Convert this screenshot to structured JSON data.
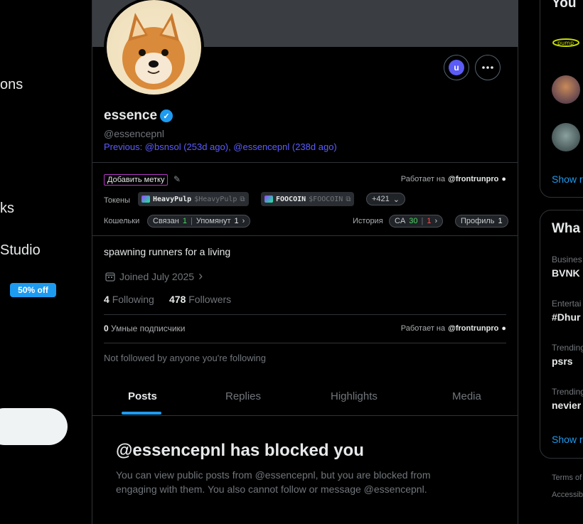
{
  "left_nav": {
    "items": [
      {
        "label": "ons"
      },
      {
        "label": "ks"
      },
      {
        "label": "Studio"
      }
    ],
    "promo_badge": "50% off"
  },
  "profile": {
    "name": "essence",
    "handle": "@essencepnl",
    "previous": "Previous: @bsnsol (253d ago), @essencepnl (238d ago)",
    "bio": "spawning runners for a living",
    "joined": "Joined July 2025",
    "following_count": "4",
    "following_label": "Following",
    "followers_count": "478",
    "followers_label": "Followers",
    "not_followed": "Not followed by anyone you're following",
    "action_avatar_letter": "u"
  },
  "extension": {
    "add_tag": "Добавить метку",
    "works_at_label": "Работает на",
    "works_at_handle": "@frontrunpro",
    "tokens_label": "Токены",
    "tokens": [
      {
        "name": "HeavyPulp",
        "symbol": "$HeavyPulp"
      },
      {
        "name": "FOOCOIN",
        "symbol": "$FOOCOIN"
      }
    ],
    "more_tokens": "+421",
    "wallets_label": "Кошельки",
    "linked_label": "Связан",
    "linked_count": "1",
    "mentioned_label": "Упомянут",
    "mentioned_count": "1",
    "history_label": "История",
    "ca_label": "CA",
    "ca_green": "30",
    "ca_red": "1",
    "profile_label": "Профиль",
    "profile_count": "1",
    "smart_followers_count": "0",
    "smart_followers_label": "Умные подписчики"
  },
  "tabs": [
    "Posts",
    "Replies",
    "Highlights",
    "Media"
  ],
  "blocked": {
    "title": "@essencepnl has blocked you",
    "text": "You can view public posts from @essencepnl, but you are blocked from engaging with them. You also cannot follow or message @essencepnl."
  },
  "right": {
    "you_title": "You",
    "show_more": "Show r",
    "whats_title": "Wha",
    "trends": [
      {
        "category": "Busines",
        "name": "BVNK"
      },
      {
        "category": "Entertai",
        "name": "#Dhur"
      },
      {
        "category": "Trending",
        "name": "psrs"
      },
      {
        "category": "Trending",
        "name": "nevier"
      }
    ],
    "show_more2": "Show r",
    "footer1": "Terms of",
    "footer2": "Accessibi"
  },
  "colors": {
    "accent": "#1d9bf0",
    "link_purple": "#5d5dff",
    "background": "#000000",
    "banner": "#3a3d41"
  }
}
